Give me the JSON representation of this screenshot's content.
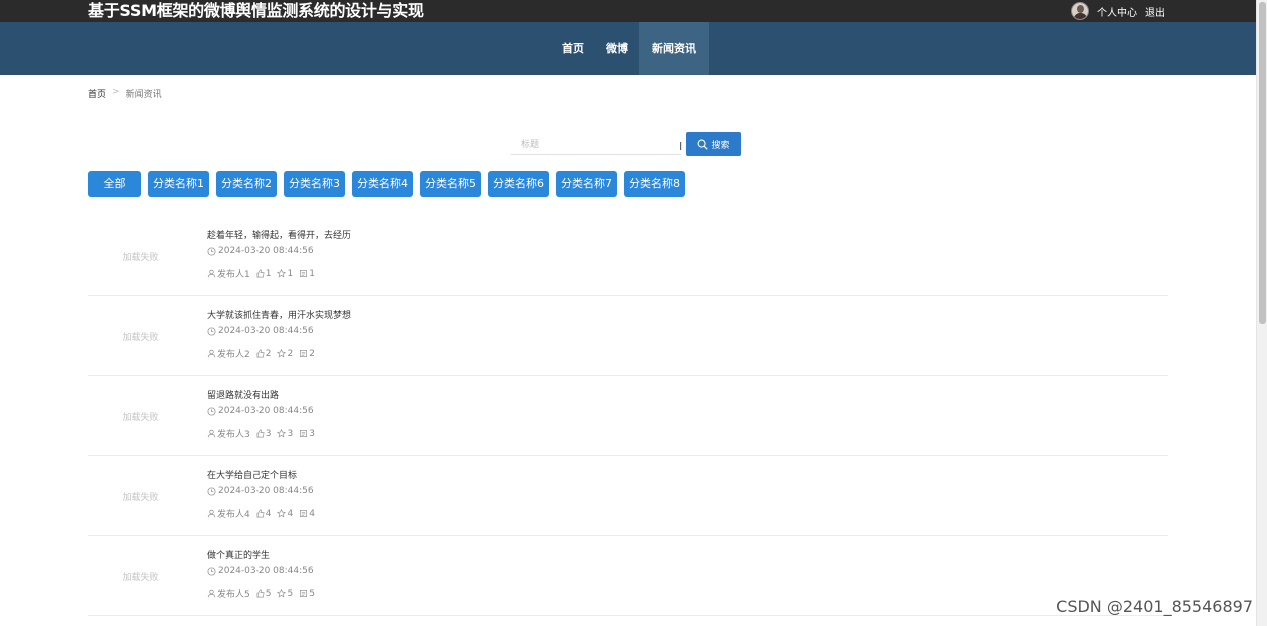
{
  "header": {
    "site_title": "基于SSM框架的微博舆情监测系统的设计与实现",
    "user_center": "个人中心",
    "logout": "退出"
  },
  "nav": {
    "items": [
      {
        "label": "首页"
      },
      {
        "label": "微博"
      },
      {
        "label": "新闻资讯",
        "active": true
      }
    ]
  },
  "breadcrumb": {
    "home": "首页",
    "separator": ">",
    "current": "新闻资讯"
  },
  "search": {
    "placeholder": "标题",
    "button_label": "搜索"
  },
  "categories": {
    "all_label": "全部",
    "items": [
      "分类名称1",
      "分类名称2",
      "分类名称3",
      "分类名称4",
      "分类名称5",
      "分类名称6",
      "分类名称7",
      "分类名称8"
    ]
  },
  "news": {
    "items": [
      {
        "image_alt": "加载失败",
        "title": "趁着年轻，输得起，看得开，去经历",
        "time": "2024-03-20 08:44:56",
        "author": "发布人1",
        "likes": "1",
        "favorites": "1",
        "comments": "1"
      },
      {
        "image_alt": "加载失败",
        "title": "大学就该抓住青春，用汗水实现梦想",
        "time": "2024-03-20 08:44:56",
        "author": "发布人2",
        "likes": "2",
        "favorites": "2",
        "comments": "2"
      },
      {
        "image_alt": "加载失败",
        "title": "留退路就没有出路",
        "time": "2024-03-20 08:44:56",
        "author": "发布人3",
        "likes": "3",
        "favorites": "3",
        "comments": "3"
      },
      {
        "image_alt": "加载失败",
        "title": "在大学给自己定个目标",
        "time": "2024-03-20 08:44:56",
        "author": "发布人4",
        "likes": "4",
        "favorites": "4",
        "comments": "4"
      },
      {
        "image_alt": "加载失败",
        "title": "做个真正的学生",
        "time": "2024-03-20 08:44:56",
        "author": "发布人5",
        "likes": "5",
        "favorites": "5",
        "comments": "5"
      }
    ]
  },
  "watermark": "CSDN @2401_85546897",
  "colors": {
    "topbar": "#2b2b2b",
    "navbar": "#2c5070",
    "nav_active": "#3e6483",
    "primary_button": "#2b87da",
    "search_button": "#2c7ac9"
  }
}
